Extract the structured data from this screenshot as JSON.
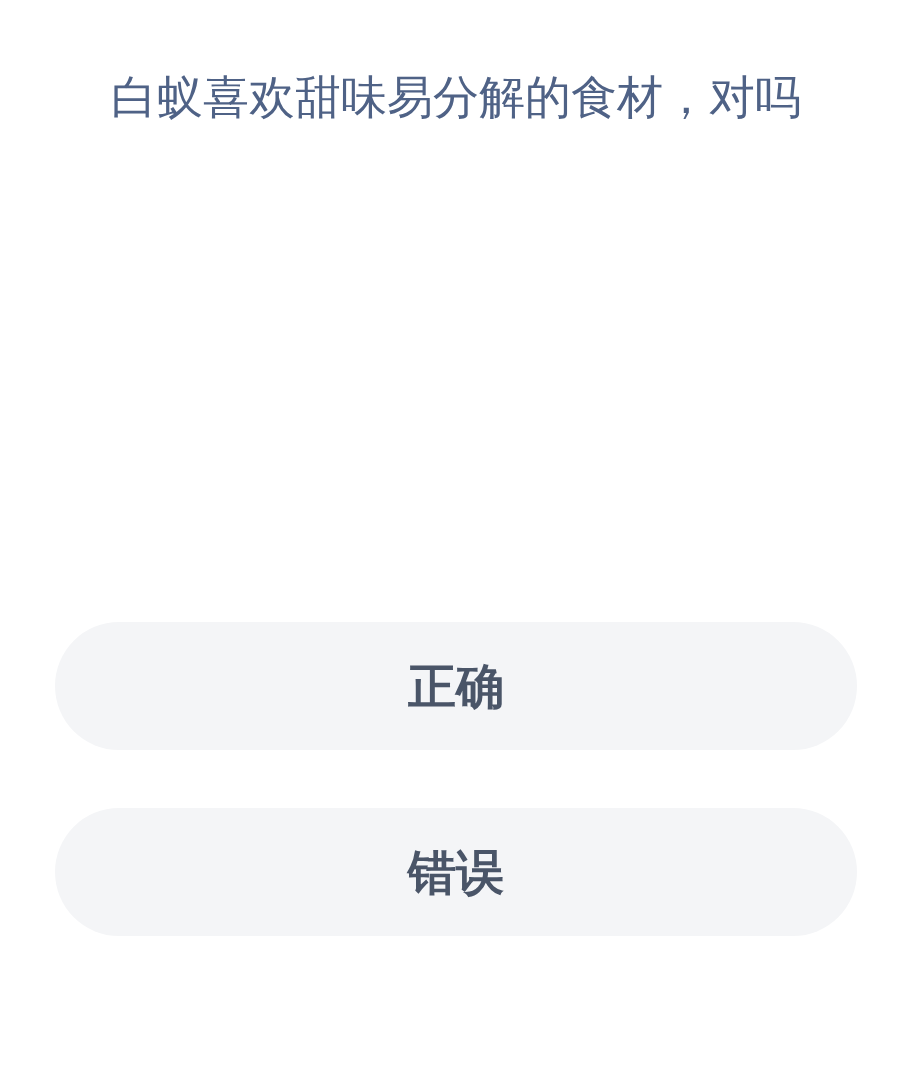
{
  "question": "白蚁喜欢甜味易分解的食材，对吗",
  "options": [
    {
      "label": "正确"
    },
    {
      "label": "错误"
    }
  ]
}
